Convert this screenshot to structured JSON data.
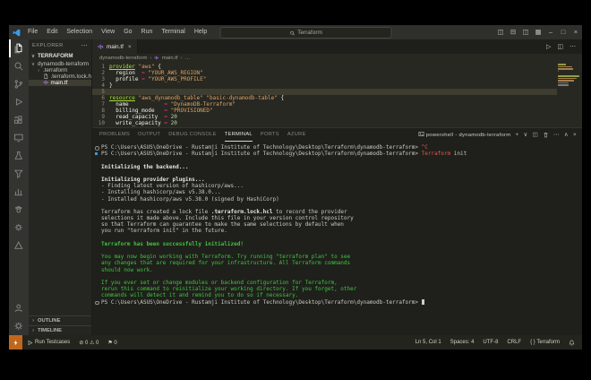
{
  "glyphs": {
    "dots": "⋯",
    "chevron_down": "∨",
    "chevron_right": "›",
    "close": "×",
    "bc_sep": "›"
  },
  "titlebar": {
    "search_value": "Terraform",
    "menus": [
      "File",
      "Edit",
      "Selection",
      "View",
      "Go",
      "Run",
      "Terminal",
      "Help"
    ],
    "nav": [
      {
        "name": "back-icon",
        "glyph": "←"
      },
      {
        "name": "forward-icon",
        "glyph": "→"
      }
    ],
    "window_icons": [
      {
        "name": "toggle-primary-sidebar-icon",
        "glyph": "◫"
      },
      {
        "name": "toggle-panel-icon",
        "glyph": "⊟"
      },
      {
        "name": "toggle-secondary-sidebar-icon",
        "glyph": "◫"
      },
      {
        "name": "customize-layout-icon",
        "glyph": "▦"
      },
      {
        "name": "minimize-icon",
        "glyph": "–"
      },
      {
        "name": "maximize-icon",
        "glyph": "□"
      },
      {
        "name": "close-icon",
        "glyph": "×"
      }
    ]
  },
  "activity_bar": {
    "top": [
      {
        "name": "explorer-icon",
        "icon": "files",
        "active": true
      },
      {
        "name": "search-icon",
        "icon": "search"
      },
      {
        "name": "source-control-icon",
        "icon": "scm"
      },
      {
        "name": "run-debug-icon",
        "icon": "debug"
      },
      {
        "name": "extensions-icon",
        "icon": "extensions"
      },
      {
        "name": "remote-explorer-icon",
        "icon": "remote"
      },
      {
        "name": "testing-icon",
        "icon": "beaker"
      },
      {
        "name": "filter-icon",
        "icon": "filter"
      },
      {
        "name": "chart-icon",
        "icon": "chart"
      },
      {
        "name": "paw-icon",
        "icon": "paw"
      },
      {
        "name": "gear-badge-icon",
        "icon": "gearsm"
      },
      {
        "name": "triangle-extension-icon",
        "icon": "tri"
      }
    ],
    "bottom": [
      {
        "name": "account-icon",
        "icon": "account"
      },
      {
        "name": "settings-gear-icon",
        "icon": "gear"
      }
    ]
  },
  "sidebar": {
    "header": "EXPLORER",
    "root": "TERRAFORM",
    "tree": [
      {
        "name": "folder-dynamodb-terraform",
        "label": "dynamodb-terraform",
        "chevron": "down",
        "indent": 0
      },
      {
        "name": "folder-dot-terraform",
        "label": ".terraform",
        "chevron": "right",
        "indent": 1
      },
      {
        "name": "file-terraform-lock-hcl",
        "label": ".terraform.lock.hcl",
        "icon": "doc",
        "indent": 1
      },
      {
        "name": "file-main-tf",
        "label": "main.tf",
        "icon": "tf",
        "indent": 1,
        "selected": true
      }
    ],
    "bottom_sections": [
      "OUTLINE",
      "TIMELINE"
    ]
  },
  "editor": {
    "tab_label": "main.tf",
    "actions": [
      {
        "name": "run-file-icon",
        "glyph": "▷"
      },
      {
        "name": "split-editor-icon",
        "glyph": "◫"
      },
      {
        "name": "editor-more-actions-icon",
        "glyph": "⋯"
      }
    ],
    "breadcrumbs": [
      {
        "label": "dynamodb-terraform"
      },
      {
        "label": "main.tf",
        "icon": "tf"
      },
      {
        "label": "…"
      }
    ],
    "active_line": "5",
    "code": [
      {
        "n": "1",
        "tokens": [
          {
            "t": "provider",
            "c": "kw"
          },
          {
            "t": " ",
            "c": "p"
          },
          {
            "t": "\"aws\"",
            "c": "str"
          },
          {
            "t": " {",
            "c": "p"
          }
        ]
      },
      {
        "n": "2",
        "tokens": [
          {
            "t": "  region  ",
            "c": "p"
          },
          {
            "t": "=",
            "c": "op"
          },
          {
            "t": " ",
            "c": "p"
          },
          {
            "t": "\"YOUR_AWS_REGION\"",
            "c": "str"
          }
        ]
      },
      {
        "n": "3",
        "tokens": [
          {
            "t": "  profile ",
            "c": "p"
          },
          {
            "t": "=",
            "c": "op"
          },
          {
            "t": " ",
            "c": "p"
          },
          {
            "t": "\"YOUR_AWS_PROFILE\"",
            "c": "str"
          }
        ]
      },
      {
        "n": "4",
        "tokens": [
          {
            "t": "}",
            "c": "p"
          }
        ]
      },
      {
        "n": "5",
        "tokens": []
      },
      {
        "n": "6",
        "tokens": [
          {
            "t": "resource",
            "c": "kw"
          },
          {
            "t": " ",
            "c": "p"
          },
          {
            "t": "\"aws_dynamodb_table\"",
            "c": "str"
          },
          {
            "t": " ",
            "c": "p"
          },
          {
            "t": "\"basic-dynamodb-table\"",
            "c": "str"
          },
          {
            "t": " {",
            "c": "p"
          }
        ]
      },
      {
        "n": "7",
        "tokens": [
          {
            "t": "  name           ",
            "c": "p"
          },
          {
            "t": "=",
            "c": "op"
          },
          {
            "t": " ",
            "c": "p"
          },
          {
            "t": "\"DynamoDB-Terraform\"",
            "c": "str"
          }
        ]
      },
      {
        "n": "8",
        "tokens": [
          {
            "t": "  billing_mode   ",
            "c": "p"
          },
          {
            "t": "=",
            "c": "op"
          },
          {
            "t": " ",
            "c": "p"
          },
          {
            "t": "\"PROVISIONED\"",
            "c": "str"
          }
        ]
      },
      {
        "n": "9",
        "tokens": [
          {
            "t": "  read_capacity  ",
            "c": "p"
          },
          {
            "t": "=",
            "c": "op"
          },
          {
            "t": " ",
            "c": "p"
          },
          {
            "t": "20",
            "c": "num"
          }
        ]
      },
      {
        "n": "10",
        "tokens": [
          {
            "t": "  write_capacity ",
            "c": "p"
          },
          {
            "t": "=",
            "c": "op"
          },
          {
            "t": " ",
            "c": "p"
          },
          {
            "t": "20",
            "c": "num"
          }
        ]
      }
    ]
  },
  "panel": {
    "tabs": [
      {
        "label": "PROBLEMS"
      },
      {
        "label": "OUTPUT"
      },
      {
        "label": "DEBUG CONSOLE"
      },
      {
        "label": "TERMINAL",
        "active": true
      },
      {
        "label": "PORTS"
      },
      {
        "label": "AZURE"
      }
    ],
    "terminal_label": "powershell - dynamodb-terraform",
    "actions": [
      {
        "name": "new-terminal-icon",
        "glyph": "+"
      },
      {
        "name": "launch-profile-chevron-icon",
        "glyph": "∨"
      },
      {
        "name": "split-terminal-icon",
        "glyph": "◫"
      },
      {
        "name": "kill-terminal-icon",
        "icon": "trash"
      },
      {
        "name": "panel-more-actions-icon",
        "glyph": "⋯"
      },
      {
        "name": "maximize-panel-icon",
        "glyph": "∧"
      },
      {
        "name": "close-panel-icon",
        "glyph": "×"
      }
    ],
    "lines": [
      {
        "deco": "circle",
        "spans": [
          {
            "t": "PS C:\\Users\\ASUS\\OneDrive - Rustamji Institute of Technology\\Desktop\\Terraform\\dynamodb-terraform> ",
            "c": "w"
          },
          {
            "t": "^C",
            "c": "r"
          }
        ]
      },
      {
        "deco": "square",
        "spans": [
          {
            "t": "PS C:\\Users\\ASUS\\OneDrive - Rustamji Institute of Technology\\Desktop\\Terraform\\dynamodb-terraform> ",
            "c": "w"
          },
          {
            "t": "Terraform",
            "c": "r"
          },
          {
            "t": " init",
            "c": "w"
          }
        ]
      },
      {
        "spans": []
      },
      {
        "spans": [
          {
            "t": "Initializing the backend...",
            "c": "b"
          }
        ]
      },
      {
        "spans": []
      },
      {
        "spans": [
          {
            "t": "Initializing provider plugins...",
            "c": "b"
          }
        ]
      },
      {
        "spans": [
          {
            "t": "- Finding latest version of hashicorp/aws...",
            "c": "w"
          }
        ]
      },
      {
        "spans": [
          {
            "t": "- Installing hashicorp/aws v5.38.0...",
            "c": "w"
          }
        ]
      },
      {
        "spans": [
          {
            "t": "- Installed hashicorp/aws v5.38.0 (signed by HashiCorp)",
            "c": "w"
          }
        ]
      },
      {
        "spans": []
      },
      {
        "spans": [
          {
            "t": "Terraform has created a lock file ",
            "c": "w"
          },
          {
            "t": ".terraform.lock.hcl",
            "c": "b"
          },
          {
            "t": " to record the provider",
            "c": "w"
          }
        ]
      },
      {
        "spans": [
          {
            "t": "selections it made above. Include this file in your version control repository",
            "c": "w"
          }
        ]
      },
      {
        "spans": [
          {
            "t": "so that Terraform can guarantee to make the same selections by default when",
            "c": "w"
          }
        ]
      },
      {
        "spans": [
          {
            "t": "you run \"terraform init\" in the future.",
            "c": "w"
          }
        ]
      },
      {
        "spans": []
      },
      {
        "spans": [
          {
            "t": "Terraform has been successfully initialized!",
            "c": "gb"
          }
        ]
      },
      {
        "spans": []
      },
      {
        "spans": [
          {
            "t": "You may now begin working with Terraform. Try running \"terraform plan\" to see",
            "c": "g"
          }
        ]
      },
      {
        "spans": [
          {
            "t": "any changes that are required for your infrastructure. All Terraform commands",
            "c": "g"
          }
        ]
      },
      {
        "spans": [
          {
            "t": "should now work.",
            "c": "g"
          }
        ]
      },
      {
        "spans": []
      },
      {
        "spans": [
          {
            "t": "If you ever set or change modules or backend configuration for Terraform,",
            "c": "g"
          }
        ]
      },
      {
        "spans": [
          {
            "t": "rerun this command to reinitialize your working directory. If you forget, other",
            "c": "g"
          }
        ]
      },
      {
        "spans": [
          {
            "t": "commands will detect it and remind you to do so if necessary.",
            "c": "g"
          }
        ]
      },
      {
        "deco": "circle",
        "cursor": true,
        "spans": [
          {
            "t": "PS C:\\Users\\ASUS\\OneDrive - Rustamji Institute of Technology\\Desktop\\Terraform\\dynamodb-terraform> ",
            "c": "w"
          }
        ]
      }
    ]
  },
  "status_bar": {
    "left": [
      {
        "name": "remote-indicator",
        "icon": "bolt",
        "accent": true,
        "text": ""
      },
      {
        "name": "run-testcases-button",
        "icon": "play",
        "text": "Run Testcases"
      },
      {
        "name": "problems-status",
        "text": "⊘ 0  ⚠ 0"
      },
      {
        "name": "flag-status",
        "text": "⚑ 0"
      }
    ],
    "right": [
      {
        "name": "cursor-position",
        "text": "Ln 5, Col 1"
      },
      {
        "name": "indentation",
        "text": "Spaces: 4"
      },
      {
        "name": "encoding",
        "text": "UTF-8"
      },
      {
        "name": "eol-sequence",
        "text": "CRLF"
      },
      {
        "name": "language-mode",
        "text": "{ } Terraform"
      },
      {
        "name": "notifications-bell-icon",
        "icon": "bell",
        "text": ""
      }
    ]
  },
  "colors": {
    "accent_orange": "#c0671c",
    "terraform_purple": "#9e6fd6",
    "success_green": "#3fc43f",
    "error_red": "#ef5350"
  }
}
